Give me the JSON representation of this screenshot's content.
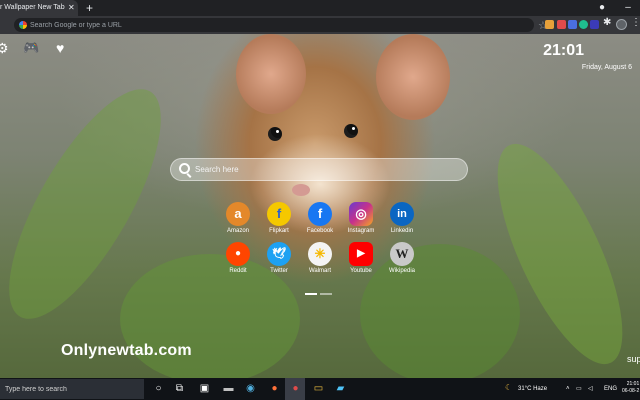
{
  "browser": {
    "tab_title": "r Wallpaper New Tab Th",
    "tab_close": "✕",
    "new_tab": "+",
    "minimize": "–",
    "profile_dot": "●",
    "omnibox_placeholder": "Search Google or type a URL"
  },
  "page": {
    "clock": "21:01",
    "date": "Friday, August 6",
    "search_placeholder": "Search here",
    "brand": "Onlynewtab.com",
    "edge_text": "sup",
    "shortcuts": [
      {
        "label": "Amazon",
        "glyph": "a",
        "color": "#e4882a"
      },
      {
        "label": "Flipkart",
        "glyph": "f",
        "color": "#f5c800"
      },
      {
        "label": "Facebook",
        "glyph": "f",
        "color": "#1877f2"
      },
      {
        "label": "Instagram",
        "glyph": "◎",
        "color": "#c7318a"
      },
      {
        "label": "Linkedin",
        "glyph": "in",
        "color": "#0a66c2"
      },
      {
        "label": "Reddit",
        "glyph": "●",
        "color": "#ff4500"
      },
      {
        "label": "Twitter",
        "glyph": "🕊",
        "color": "#1da1f2"
      },
      {
        "label": "Walmart",
        "glyph": "✳",
        "color": "#f4f4f4"
      },
      {
        "label": "Youtube",
        "glyph": "▶",
        "color": "#ff0000"
      },
      {
        "label": "Wikipedia",
        "glyph": "W",
        "color": "#c9c9c9"
      }
    ]
  },
  "taskbar": {
    "search_placeholder": "Type here to search",
    "weather": "31°C  Haze",
    "language": "ENG",
    "time": "21:01",
    "date": "06-08-2"
  },
  "colors": {
    "accent": "#35363a",
    "taskbar": "#101317"
  }
}
